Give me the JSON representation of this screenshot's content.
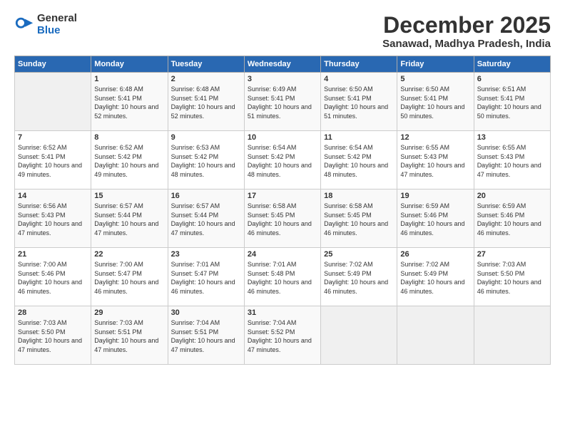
{
  "logo": {
    "general": "General",
    "blue": "Blue"
  },
  "header": {
    "month": "December 2025",
    "location": "Sanawad, Madhya Pradesh, India"
  },
  "weekdays": [
    "Sunday",
    "Monday",
    "Tuesday",
    "Wednesday",
    "Thursday",
    "Friday",
    "Saturday"
  ],
  "weeks": [
    [
      {
        "day": "",
        "sunrise": "",
        "sunset": "",
        "daylight": ""
      },
      {
        "day": "1",
        "sunrise": "Sunrise: 6:48 AM",
        "sunset": "Sunset: 5:41 PM",
        "daylight": "Daylight: 10 hours and 52 minutes."
      },
      {
        "day": "2",
        "sunrise": "Sunrise: 6:48 AM",
        "sunset": "Sunset: 5:41 PM",
        "daylight": "Daylight: 10 hours and 52 minutes."
      },
      {
        "day": "3",
        "sunrise": "Sunrise: 6:49 AM",
        "sunset": "Sunset: 5:41 PM",
        "daylight": "Daylight: 10 hours and 51 minutes."
      },
      {
        "day": "4",
        "sunrise": "Sunrise: 6:50 AM",
        "sunset": "Sunset: 5:41 PM",
        "daylight": "Daylight: 10 hours and 51 minutes."
      },
      {
        "day": "5",
        "sunrise": "Sunrise: 6:50 AM",
        "sunset": "Sunset: 5:41 PM",
        "daylight": "Daylight: 10 hours and 50 minutes."
      },
      {
        "day": "6",
        "sunrise": "Sunrise: 6:51 AM",
        "sunset": "Sunset: 5:41 PM",
        "daylight": "Daylight: 10 hours and 50 minutes."
      }
    ],
    [
      {
        "day": "7",
        "sunrise": "Sunrise: 6:52 AM",
        "sunset": "Sunset: 5:41 PM",
        "daylight": "Daylight: 10 hours and 49 minutes."
      },
      {
        "day": "8",
        "sunrise": "Sunrise: 6:52 AM",
        "sunset": "Sunset: 5:42 PM",
        "daylight": "Daylight: 10 hours and 49 minutes."
      },
      {
        "day": "9",
        "sunrise": "Sunrise: 6:53 AM",
        "sunset": "Sunset: 5:42 PM",
        "daylight": "Daylight: 10 hours and 48 minutes."
      },
      {
        "day": "10",
        "sunrise": "Sunrise: 6:54 AM",
        "sunset": "Sunset: 5:42 PM",
        "daylight": "Daylight: 10 hours and 48 minutes."
      },
      {
        "day": "11",
        "sunrise": "Sunrise: 6:54 AM",
        "sunset": "Sunset: 5:42 PM",
        "daylight": "Daylight: 10 hours and 48 minutes."
      },
      {
        "day": "12",
        "sunrise": "Sunrise: 6:55 AM",
        "sunset": "Sunset: 5:43 PM",
        "daylight": "Daylight: 10 hours and 47 minutes."
      },
      {
        "day": "13",
        "sunrise": "Sunrise: 6:55 AM",
        "sunset": "Sunset: 5:43 PM",
        "daylight": "Daylight: 10 hours and 47 minutes."
      }
    ],
    [
      {
        "day": "14",
        "sunrise": "Sunrise: 6:56 AM",
        "sunset": "Sunset: 5:43 PM",
        "daylight": "Daylight: 10 hours and 47 minutes."
      },
      {
        "day": "15",
        "sunrise": "Sunrise: 6:57 AM",
        "sunset": "Sunset: 5:44 PM",
        "daylight": "Daylight: 10 hours and 47 minutes."
      },
      {
        "day": "16",
        "sunrise": "Sunrise: 6:57 AM",
        "sunset": "Sunset: 5:44 PM",
        "daylight": "Daylight: 10 hours and 47 minutes."
      },
      {
        "day": "17",
        "sunrise": "Sunrise: 6:58 AM",
        "sunset": "Sunset: 5:45 PM",
        "daylight": "Daylight: 10 hours and 46 minutes."
      },
      {
        "day": "18",
        "sunrise": "Sunrise: 6:58 AM",
        "sunset": "Sunset: 5:45 PM",
        "daylight": "Daylight: 10 hours and 46 minutes."
      },
      {
        "day": "19",
        "sunrise": "Sunrise: 6:59 AM",
        "sunset": "Sunset: 5:46 PM",
        "daylight": "Daylight: 10 hours and 46 minutes."
      },
      {
        "day": "20",
        "sunrise": "Sunrise: 6:59 AM",
        "sunset": "Sunset: 5:46 PM",
        "daylight": "Daylight: 10 hours and 46 minutes."
      }
    ],
    [
      {
        "day": "21",
        "sunrise": "Sunrise: 7:00 AM",
        "sunset": "Sunset: 5:46 PM",
        "daylight": "Daylight: 10 hours and 46 minutes."
      },
      {
        "day": "22",
        "sunrise": "Sunrise: 7:00 AM",
        "sunset": "Sunset: 5:47 PM",
        "daylight": "Daylight: 10 hours and 46 minutes."
      },
      {
        "day": "23",
        "sunrise": "Sunrise: 7:01 AM",
        "sunset": "Sunset: 5:47 PM",
        "daylight": "Daylight: 10 hours and 46 minutes."
      },
      {
        "day": "24",
        "sunrise": "Sunrise: 7:01 AM",
        "sunset": "Sunset: 5:48 PM",
        "daylight": "Daylight: 10 hours and 46 minutes."
      },
      {
        "day": "25",
        "sunrise": "Sunrise: 7:02 AM",
        "sunset": "Sunset: 5:49 PM",
        "daylight": "Daylight: 10 hours and 46 minutes."
      },
      {
        "day": "26",
        "sunrise": "Sunrise: 7:02 AM",
        "sunset": "Sunset: 5:49 PM",
        "daylight": "Daylight: 10 hours and 46 minutes."
      },
      {
        "day": "27",
        "sunrise": "Sunrise: 7:03 AM",
        "sunset": "Sunset: 5:50 PM",
        "daylight": "Daylight: 10 hours and 46 minutes."
      }
    ],
    [
      {
        "day": "28",
        "sunrise": "Sunrise: 7:03 AM",
        "sunset": "Sunset: 5:50 PM",
        "daylight": "Daylight: 10 hours and 47 minutes."
      },
      {
        "day": "29",
        "sunrise": "Sunrise: 7:03 AM",
        "sunset": "Sunset: 5:51 PM",
        "daylight": "Daylight: 10 hours and 47 minutes."
      },
      {
        "day": "30",
        "sunrise": "Sunrise: 7:04 AM",
        "sunset": "Sunset: 5:51 PM",
        "daylight": "Daylight: 10 hours and 47 minutes."
      },
      {
        "day": "31",
        "sunrise": "Sunrise: 7:04 AM",
        "sunset": "Sunset: 5:52 PM",
        "daylight": "Daylight: 10 hours and 47 minutes."
      },
      {
        "day": "",
        "sunrise": "",
        "sunset": "",
        "daylight": ""
      },
      {
        "day": "",
        "sunrise": "",
        "sunset": "",
        "daylight": ""
      },
      {
        "day": "",
        "sunrise": "",
        "sunset": "",
        "daylight": ""
      }
    ]
  ]
}
